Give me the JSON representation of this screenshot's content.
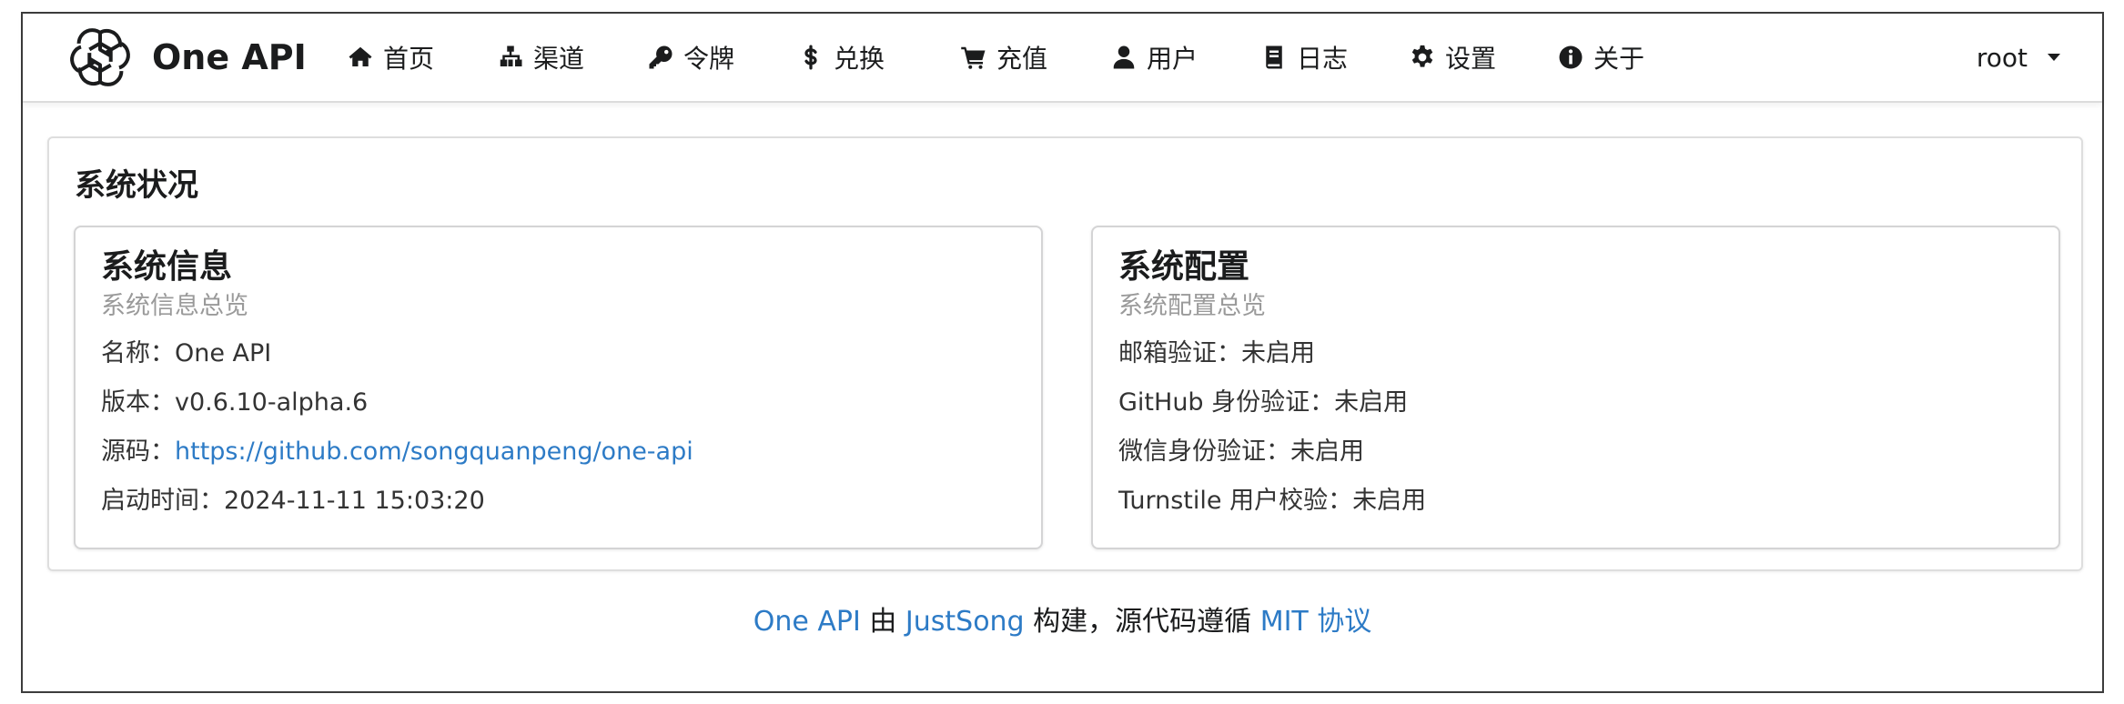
{
  "header": {
    "brand": "One API",
    "nav": [
      {
        "label": "首页",
        "icon": "home-icon"
      },
      {
        "label": "渠道",
        "icon": "sitemap-icon"
      },
      {
        "label": "令牌",
        "icon": "key-icon"
      },
      {
        "label": "兑换",
        "icon": "dollar-icon"
      },
      {
        "label": "充值",
        "icon": "cart-icon"
      },
      {
        "label": "用户",
        "icon": "user-icon"
      },
      {
        "label": "日志",
        "icon": "book-icon"
      },
      {
        "label": "设置",
        "icon": "gear-icon"
      },
      {
        "label": "关于",
        "icon": "info-icon"
      }
    ],
    "user": "root"
  },
  "main": {
    "title": "系统状况",
    "info_card": {
      "header": "系统信息",
      "meta": "系统信息总览",
      "name_label": "名称：",
      "name_value": "One API",
      "version_label": "版本：",
      "version_value": "v0.6.10-alpha.6",
      "source_label": "源码：",
      "source_link": "https://github.com/songquanpeng/one-api",
      "start_label": "启动时间：",
      "start_value": "2024-11-11 15:03:20"
    },
    "config_card": {
      "header": "系统配置",
      "meta": "系统配置总览",
      "email_label": "邮箱验证：",
      "email_value": "未启用",
      "github_label": "GitHub 身份验证：",
      "github_value": "未启用",
      "wechat_label": "微信身份验证：",
      "wechat_value": "未启用",
      "turnstile_label": "Turnstile 用户校验：",
      "turnstile_value": "未启用"
    }
  },
  "footer": {
    "project": "One API",
    "by": " 由 ",
    "author": "JustSong",
    "built": " 构建，源代码遵循 ",
    "license": "MIT 协议"
  },
  "colors": {
    "link": "#2d7bc6",
    "muted": "#9a9a9a",
    "border": "#d4d4d5"
  }
}
